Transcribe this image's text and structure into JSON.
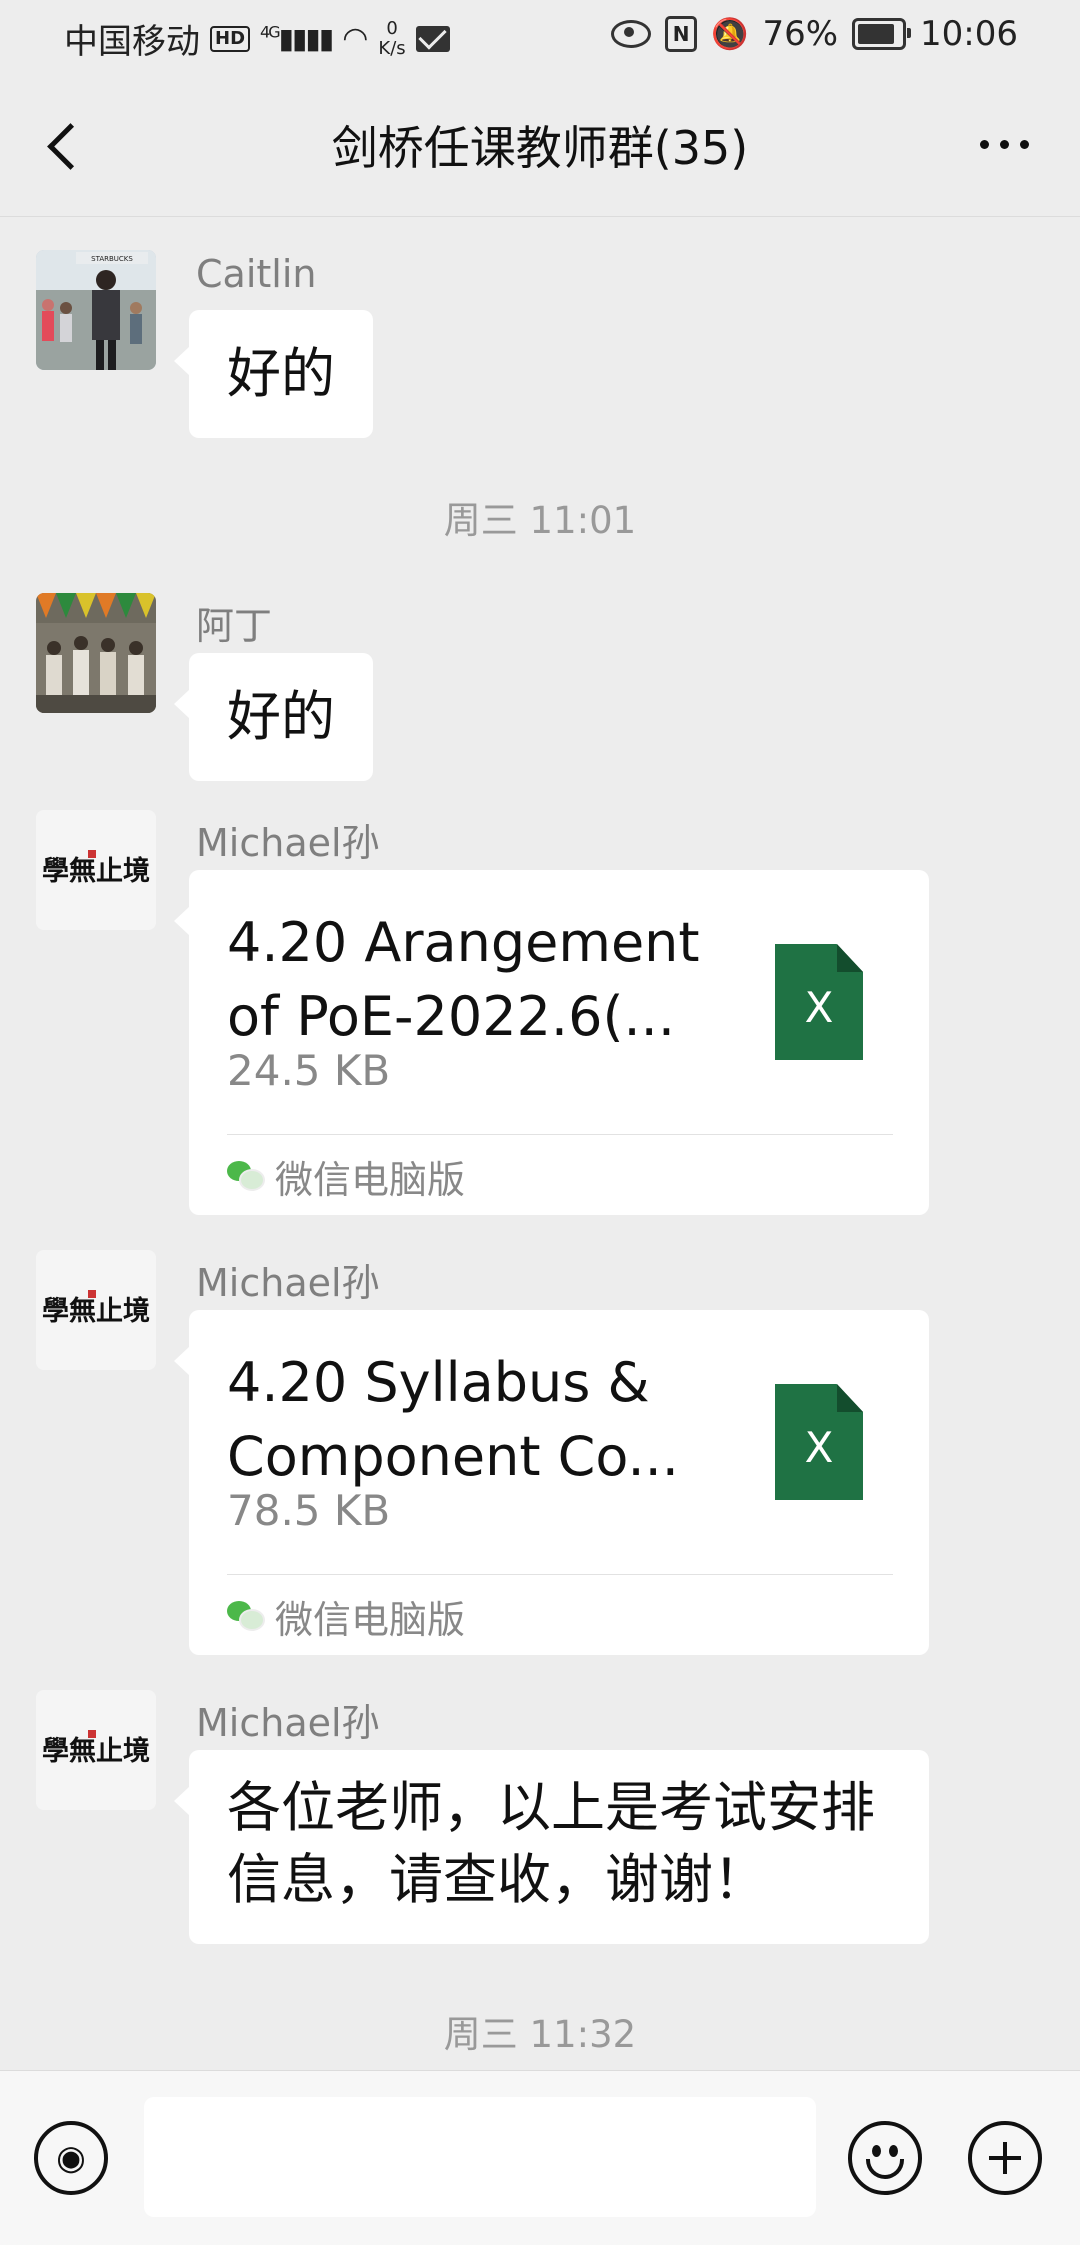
{
  "status_bar": {
    "carrier": "中国移动",
    "hd": "HD",
    "network": "4G",
    "speed_value": "0",
    "speed_unit": "K/s",
    "battery_percent": "76%",
    "battery_level": 0.76,
    "time": "10:06",
    "icons": [
      "hd-icon",
      "signal-icon",
      "wifi-icon",
      "mail-icon",
      "eye-icon",
      "nfc-icon",
      "mute-bell-icon",
      "battery-icon"
    ]
  },
  "header": {
    "title": "剑桥任课教师群(35)",
    "icons": [
      "back-chevron-icon",
      "more-dots-icon"
    ]
  },
  "messages": [
    {
      "type": "text",
      "sender": "Caitlin",
      "text": "好的"
    },
    {
      "type": "timestamp",
      "text": "周三 11:01"
    },
    {
      "type": "text",
      "sender": "阿丁",
      "text": "好的"
    },
    {
      "type": "file",
      "sender": "Michael孙",
      "file_name_line1": "4.20 Arangement",
      "file_name_line2": "of PoE-2022.6(...",
      "file_size": "24.5 KB",
      "source": "微信电脑版",
      "file_icon_letter": "X"
    },
    {
      "type": "file",
      "sender": "Michael孙",
      "file_name_line1": "4.20 Syllabus &",
      "file_name_line2": "Component Co...",
      "file_size": "78.5 KB",
      "source": "微信电脑版",
      "file_icon_letter": "X"
    },
    {
      "type": "text",
      "sender": "Michael孙",
      "text_line1": "各位老师，以上是考试安排",
      "text_line2": "信息，请查收，谢谢！"
    },
    {
      "type": "timestamp",
      "text": "周三 11:32"
    }
  ],
  "avatars": {
    "caitlin_sign_text": "STARBUCKS",
    "michael_calligraphy": "學無止境"
  },
  "input_bar": {
    "input_value": "",
    "icons": [
      "voice-icon",
      "emoji-icon",
      "plus-icon"
    ]
  },
  "colors": {
    "background": "#ededed",
    "bubble": "#ffffff",
    "excel_green": "#1f7244",
    "wechat_green": "#4cb84a"
  }
}
